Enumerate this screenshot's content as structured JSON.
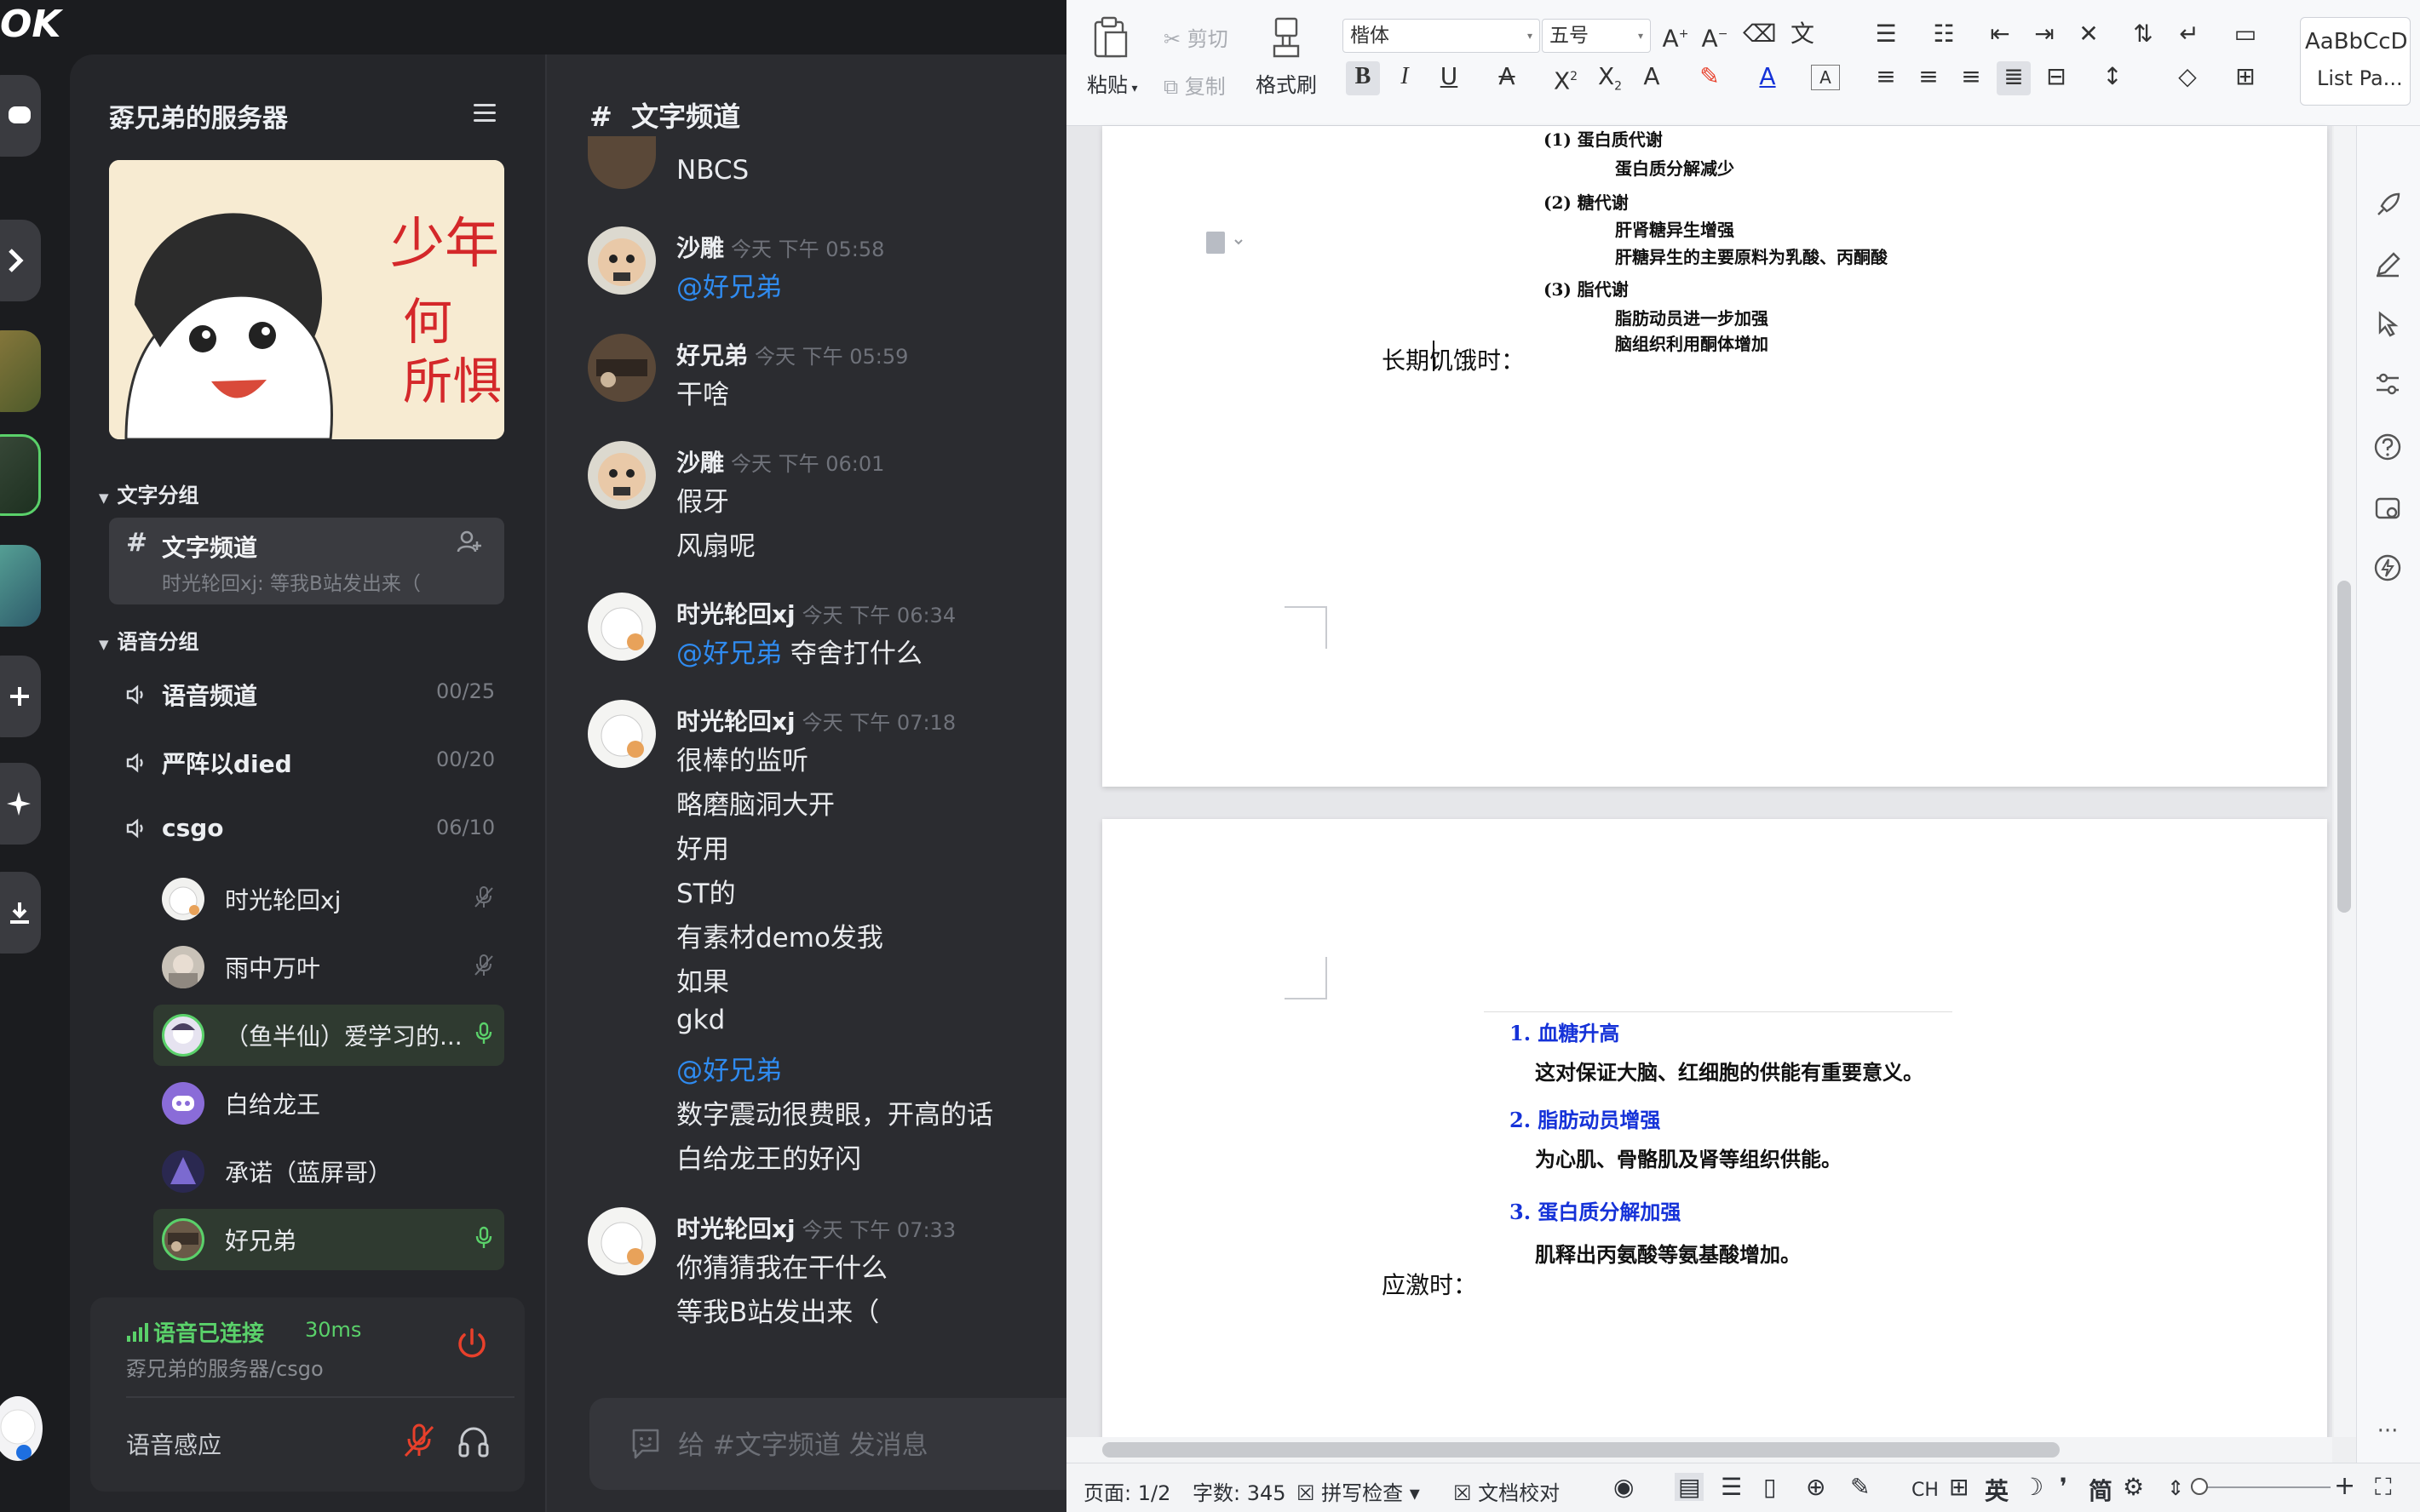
{
  "kook": {
    "logo": "OK",
    "rail_icons": [
      "message-icon",
      "badge-icon",
      "add-icon",
      "sparkle-icon",
      "download-icon"
    ],
    "server": {
      "title": "孬兄弟的服务器",
      "text_group": "文字分组",
      "voice_group": "语音分组",
      "active_channel": {
        "name": "文字频道",
        "preview": "时光轮回xj: 等我B站发出来（"
      },
      "voice_channels": [
        {
          "name": "语音频道",
          "count": "00/25"
        },
        {
          "name": "严阵以died",
          "count": "00/20"
        },
        {
          "name": "csgo",
          "count": "06/10"
        }
      ],
      "members": [
        {
          "name": "时光轮回xj",
          "status": "muted"
        },
        {
          "name": "雨中万叶",
          "status": "muted"
        },
        {
          "name": "（鱼半仙）爱学习的...",
          "status": "speaking"
        },
        {
          "name": "白给龙王",
          "status": ""
        },
        {
          "name": "承诺（蓝屏哥）",
          "status": ""
        },
        {
          "name": "好兄弟",
          "status": "speaking"
        }
      ],
      "voice_panel": {
        "status": "语音已连接",
        "latency": "30ms",
        "path": "孬兄弟的服务器/csgo",
        "mode": "语音感应"
      }
    },
    "chat": {
      "title": "文字频道",
      "top_partial": "NBCS",
      "messages": [
        {
          "author": "沙雕",
          "time": "今天 下午 05:58",
          "lines": [
            {
              "text": "@好兄弟",
              "mention": true
            }
          ]
        },
        {
          "author": "好兄弟",
          "time": "今天 下午 05:59",
          "lines": [
            {
              "text": "干啥"
            }
          ]
        },
        {
          "author": "沙雕",
          "time": "今天 下午 06:01",
          "lines": [
            {
              "text": "假牙"
            },
            {
              "text": "风扇呢"
            }
          ]
        },
        {
          "author": "时光轮回xj",
          "time": "今天 下午 06:34",
          "lines": [
            {
              "text": "@好兄弟",
              "mention": true,
              "rest": " 夺舍打什么"
            }
          ]
        },
        {
          "author": "时光轮回xj",
          "time": "今天 下午 07:18",
          "lines": [
            {
              "text": "很棒的监听"
            },
            {
              "text": "略磨脑洞大开"
            },
            {
              "text": "好用"
            },
            {
              "text": "ST的"
            },
            {
              "text": "有素材demo发我"
            },
            {
              "text": "如果"
            },
            {
              "text": "gkd"
            },
            {
              "text": "@好兄弟",
              "mention": true
            },
            {
              "text": "数字震动很费眼，开高的话"
            },
            {
              "text": "白给龙王的好闪"
            }
          ]
        },
        {
          "author": "时光轮回xj",
          "time": "今天 下午 07:33",
          "lines": [
            {
              "text": "你猜猜我在干什么"
            },
            {
              "text": "等我B站发出来（"
            }
          ]
        }
      ],
      "input_placeholder": "给 #文字频道 发消息"
    }
  },
  "wps": {
    "ribbon": {
      "paste": "粘贴",
      "cut": "剪切",
      "copy": "复制",
      "format_painter": "格式刷",
      "font_name": "楷体",
      "font_size": "五号",
      "style_preview": "AaBbCcD",
      "style_name": "List Pa..."
    },
    "page1": {
      "items": [
        {
          "label": "(1) 蛋白质代谢",
          "subs": [
            "蛋白质分解减少"
          ]
        },
        {
          "label": "(2) 糖代谢",
          "subs": [
            "肝肾糖异生增强",
            "肝糖异生的主要原料为乳酸、丙酮酸"
          ]
        },
        {
          "label": "(3) 脂代谢",
          "subs": [
            "脂肪动员进一步加强",
            "脑组织利用酮体增加"
          ]
        }
      ],
      "heading": "长期饥饿时："
    },
    "page2": {
      "points": [
        {
          "num": "1.",
          "title": "血糖升高",
          "desc": "这对保证大脑、红细胞的供能有重要意义。"
        },
        {
          "num": "2.",
          "title": "脂肪动员增强",
          "desc": "为心肌、骨骼肌及肾等组织供能。"
        },
        {
          "num": "3.",
          "title": "蛋白质分解加强",
          "desc": "肌释出丙氨酸等氨基酸增加。"
        }
      ],
      "heading": "应激时："
    },
    "status": {
      "page": "页面: 1/2",
      "words": "字数: 345",
      "spell": "拼写检查",
      "proof": "文档校对",
      "lang1": "CH",
      "lang2": "英",
      "lang3": "简"
    }
  }
}
